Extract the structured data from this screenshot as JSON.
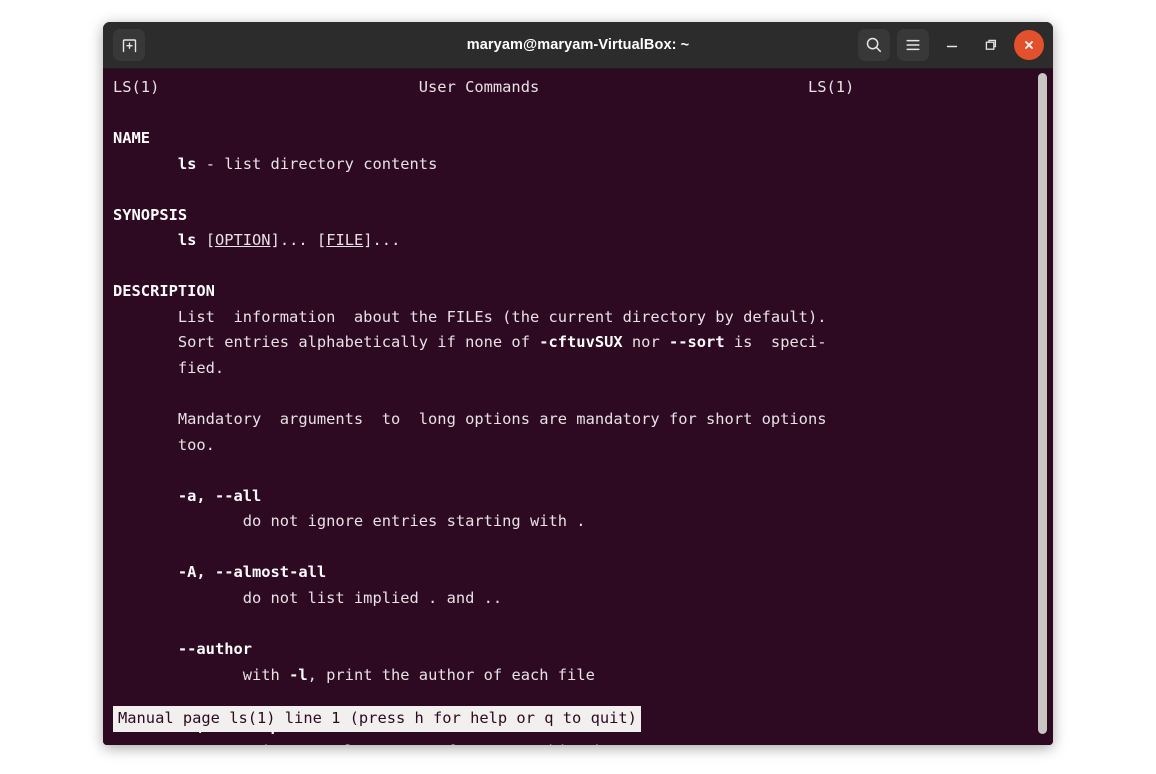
{
  "window": {
    "title": "maryam@maryam-VirtualBox: ~",
    "colors": {
      "titlebar_bg": "#2c2c2c",
      "terminal_bg": "#2d0922",
      "terminal_fg": "#e7e2e4",
      "close_button": "#e3502a",
      "status_bar_bg": "#f2f0ee",
      "scrollbar": "#c9c5c2"
    },
    "titlebar_buttons": {
      "new_tab": "new-tab-icon",
      "search": "search-icon",
      "menu": "hamburger-menu-icon",
      "minimize": "minimize-icon",
      "maximize": "maximize-icon",
      "close": "close-icon"
    }
  },
  "man_page": {
    "header": {
      "left": "LS(1)",
      "center": "User Commands",
      "right": "LS(1)"
    },
    "sections": [
      {
        "heading": "NAME",
        "lines": [
          "       ls - list directory contents"
        ]
      },
      {
        "heading": "SYNOPSIS",
        "lines": [
          "       ls [OPTION]... [FILE]..."
        ]
      },
      {
        "heading": "DESCRIPTION",
        "lines": [
          "       List  information  about the FILEs (the current directory by default).",
          "       Sort entries alphabetically if none of -cftuvSUX nor --sort is  speci-",
          "       fied.",
          "",
          "       Mandatory  arguments  to  long options are mandatory for short options",
          "       too.",
          "",
          "       -a, --all",
          "              do not ignore entries starting with .",
          "",
          "       -A, --almost-all",
          "              do not list implied . and ..",
          "",
          "       --author",
          "              with -l, print the author of each file",
          "",
          "       -b, --escape",
          "              print C-style escapes for nongraphic characters"
        ]
      }
    ],
    "bold_terms": [
      "NAME",
      "SYNOPSIS",
      "DESCRIPTION",
      "ls",
      "-cftuvSUX",
      "--sort",
      "-a, --all",
      "-A, --almost-all",
      "--author",
      "-l",
      "-b, --escape"
    ],
    "underlined_terms": [
      "OPTION",
      "FILE"
    ]
  },
  "status_bar": {
    "text": "Manual page ls(1) line 1 (press h for help or q to quit)"
  }
}
